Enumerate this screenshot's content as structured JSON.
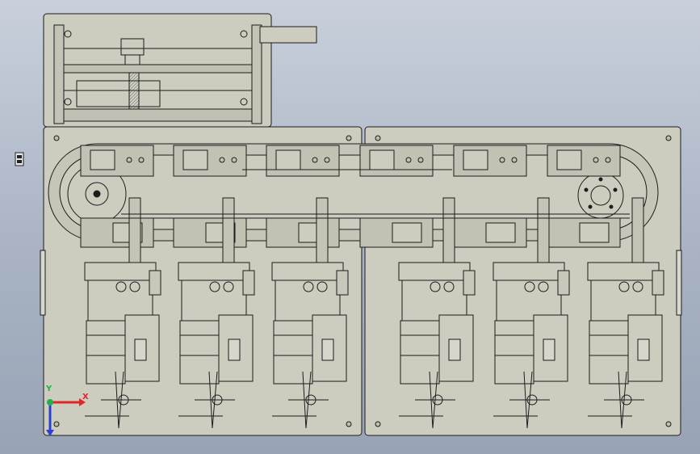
{
  "app": {
    "window_title": "",
    "view": "front"
  },
  "colors": {
    "background_top": "#c9d0dc",
    "background_bottom": "#98a3b5",
    "plate": "#cdcdbf",
    "line": "#1c1c1c",
    "axis_x": "#e0262a",
    "axis_y": "#22b04a",
    "axis_z": "#2a3fd6"
  },
  "model": {
    "stations": 6,
    "description_icon": "cad-assembly-icon"
  },
  "triad": {
    "x_label": "X",
    "y_label": "Y"
  }
}
